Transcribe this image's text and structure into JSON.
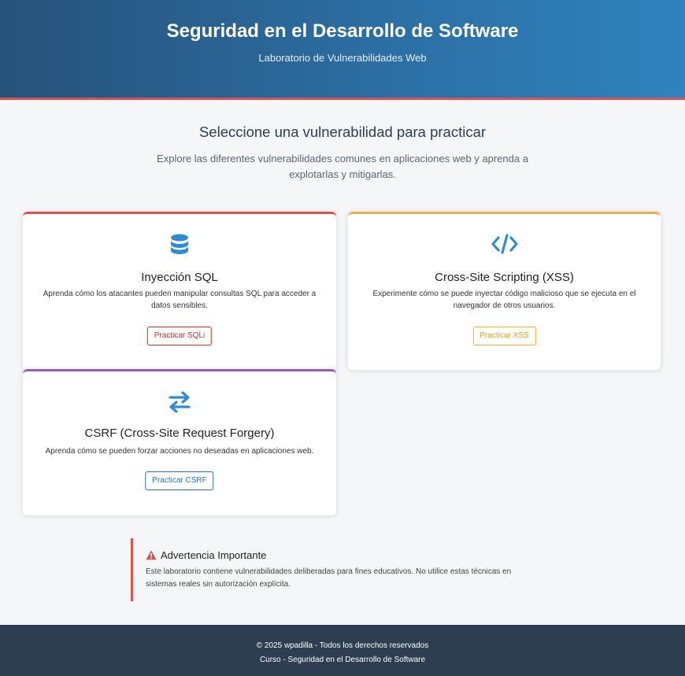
{
  "header": {
    "title": "Seguridad en el Desarrollo de Software",
    "subtitle": "Laboratorio de Vulnerabilidades Web"
  },
  "intro": {
    "title": "Seleccione una vulnerabilidad para practicar",
    "text": "Explore las diferentes vulnerabilidades comunes en aplicaciones web y aprenda a explotarlas y mitigarlas."
  },
  "cards": [
    {
      "icon": "database-icon",
      "title": "Inyección SQL",
      "description": "Aprenda cómo los atacantes pueden manipular consultas SQL para acceder a datos sensibles.",
      "button": "Practicar SQLi",
      "accent": "#d9534f"
    },
    {
      "icon": "code-icon",
      "title": "Cross-Site Scripting (XSS)",
      "description": "Experimente cómo se puede inyectar código malicioso que se ejecuta en el navegador de otros usuarios.",
      "button": "Practicar XSS",
      "accent": "#f0ad4e"
    },
    {
      "icon": "exchange-arrows-icon",
      "title": "CSRF (Cross-Site Request Forgery)",
      "description": "Aprenda cómo se pueden forzar acciones no deseadas en aplicaciones web.",
      "button": "Practicar CSRF",
      "accent": "#9b59b6"
    }
  ],
  "warning": {
    "icon": "warning-triangle-icon",
    "title": "Advertencia Importante",
    "text": "Este laboratorio contiene vulnerabilidades deliberadas para fines educativos. No utilice estas técnicas en sistemas reales sin autorización explícita."
  },
  "footer": {
    "line1": "© 2025 wpadilla - Todos los derechos reservados",
    "line2": "Curso - Seguridad en el Desarrollo de Software"
  },
  "colors": {
    "primary": "#2c6ea3",
    "danger": "#d9534f",
    "warning": "#f0ad4e",
    "purple": "#9b59b6",
    "footer": "#2c3e50",
    "icon": "#2f8bd1"
  }
}
